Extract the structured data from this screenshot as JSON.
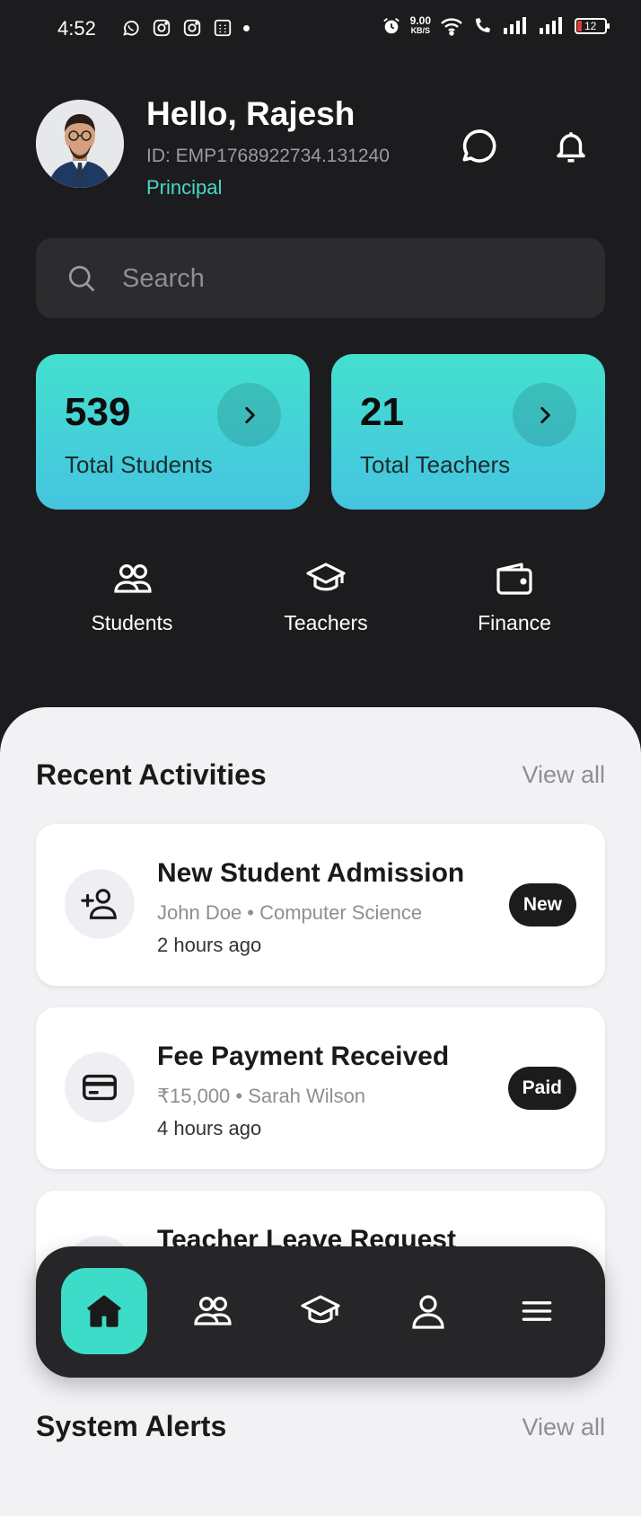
{
  "status_bar": {
    "time": "4:52",
    "speed_value": "9.00",
    "speed_unit": "KB/S",
    "battery_level": "12"
  },
  "header": {
    "greeting": "Hello, Rajesh",
    "employee_id": "ID: EMP1768922734.131240",
    "role": "Principal",
    "icons": [
      "chat-icon",
      "bell-icon"
    ]
  },
  "search": {
    "placeholder": "Search"
  },
  "stats": [
    {
      "value": "539",
      "label": "Total Students"
    },
    {
      "value": "21",
      "label": "Total Teachers"
    }
  ],
  "quick_actions": [
    {
      "label": "Students",
      "icon": "users-icon"
    },
    {
      "label": "Teachers",
      "icon": "graduation-cap-icon"
    },
    {
      "label": "Finance",
      "icon": "wallet-icon"
    }
  ],
  "recent_activities": {
    "title": "Recent Activities",
    "view_all": "View all",
    "items": [
      {
        "title": "New Student Admission",
        "subtitle": "John Doe • Computer Science",
        "time": "2 hours ago",
        "badge": "New",
        "icon": "user-add-icon"
      },
      {
        "title": "Fee Payment Received",
        "subtitle": "₹15,000 • Sarah Wilson",
        "time": "4 hours ago",
        "badge": "Paid",
        "icon": "credit-card-icon"
      },
      {
        "title": "Teacher Leave Request",
        "icon": "calendar-icon"
      }
    ]
  },
  "system_alerts": {
    "title": "System Alerts",
    "view_all": "View all"
  },
  "bottom_nav": {
    "items": [
      "home-icon",
      "users-icon",
      "graduation-cap-icon",
      "profile-icon",
      "menu-icon"
    ],
    "active": "home-icon"
  },
  "colors": {
    "background": "#1c1c1e",
    "accent": "#3ddcc9",
    "role_text": "#47d8c8",
    "sheet": "#f2f2f5"
  }
}
